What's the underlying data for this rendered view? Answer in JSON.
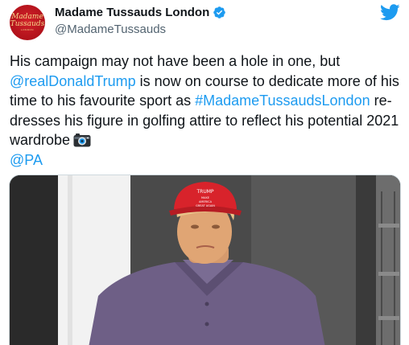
{
  "account": {
    "display_name": "Madame Tussauds London",
    "handle": "@MadameTussauds",
    "avatar_text": [
      "Madame",
      "Tussauds",
      "LONDON"
    ],
    "verified": true
  },
  "tweet": {
    "parts": [
      "His campaign may not have been a hole in one, but ",
      "@realDonaldTrump",
      " is now on course to dedicate more of his time to his favourite sport as ",
      "#MadameTussaudsLondon",
      " re-dresses his figure in golfing attire to reflect his potential 2021 wardrobe",
      "@PA"
    ]
  },
  "media": {
    "cap_text": [
      "TRUMP",
      "MAKE",
      "AMERICA",
      "GREAT AGAIN"
    ]
  },
  "colors": {
    "accent": "#1d9bf0",
    "brand_red": "#b1121b"
  },
  "icons": [
    "verified-badge-icon",
    "twitter-bird-icon",
    "camera-icon"
  ]
}
